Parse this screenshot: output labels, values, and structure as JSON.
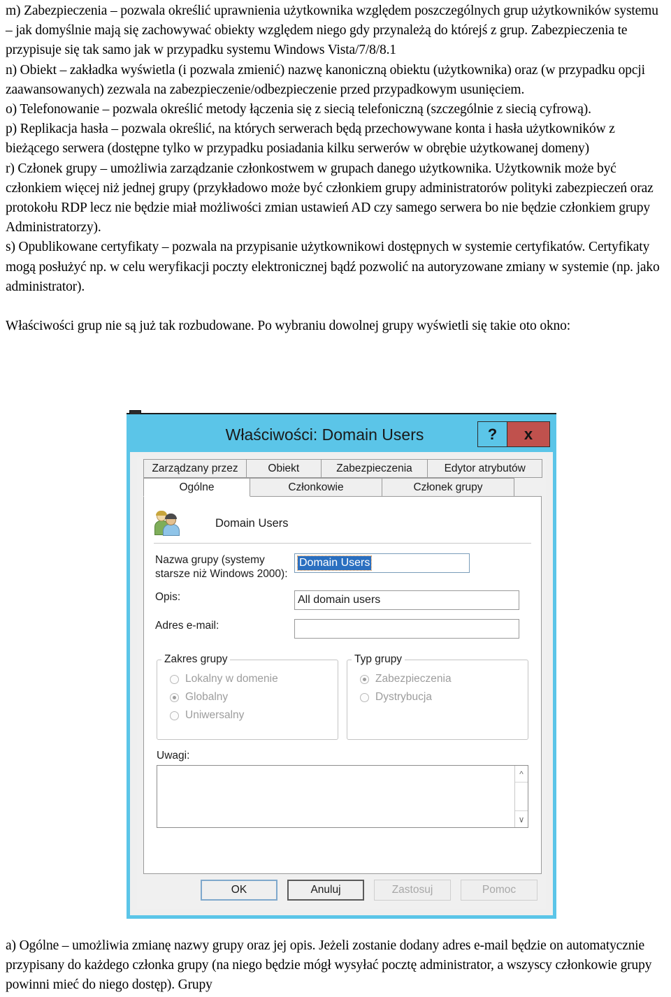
{
  "document": {
    "paragraphs": [
      "m) Zabezpieczenia – pozwala określić uprawnienia użytkownika względem poszczególnych grup użytkowników systemu – jak domyślnie mają się zachowywać obiekty względem niego gdy przynależą do którejś z grup. Zabezpieczenia te przypisuje się tak samo jak w przypadku systemu Windows Vista/7/8/8.1",
      "n) Obiekt – zakładka wyświetla (i pozwala zmienić) nazwę kanoniczną obiektu (użytkownika) oraz (w przypadku opcji zaawansowanych) zezwala na zabezpieczenie/odbezpieczenie przed przypadkowym usunięciem.",
      "o) Telefonowanie – pozwala określić metody łączenia się z siecią telefoniczną (szczególnie z siecią cyfrową).",
      "p) Replikacja hasła – pozwala określić, na których serwerach będą przechowywane konta i hasła użytkowników z bieżącego serwera (dostępne tylko w przypadku posiadania kilku serwerów w obrębie użytkowanej domeny)",
      "r) Członek grupy – umożliwia zarządzanie członkostwem w grupach danego użytkownika. Użytkownik może być członkiem więcej niż jednej grupy (przykładowo może być członkiem grupy administratorów polityki zabezpieczeń oraz protokołu RDP lecz nie będzie miał możliwości zmian ustawień AD czy samego serwera bo nie będzie członkiem grupy Administratorzy).",
      "s) Opublikowane certyfikaty – pozwala na przypisanie użytkownikowi dostępnych w systemie certyfikatów. Certyfikaty mogą posłużyć np. w celu weryfikacji poczty elektronicznej bądź pozwolić na autoryzowane zmiany w systemie (np. jako administrator)."
    ],
    "intro_paragraph": "Właściwości grup nie są już tak rozbudowane. Po wybraniu dowolnej grupy wyświetli się takie oto okno:",
    "closing_paragraph": "a) Ogólne – umożliwia zmianę nazwy grupy oraz jej opis. Jeżeli zostanie dodany adres e-mail będzie on automatycznie przypisany do każdego członka grupy (na niego będzie mógł wysyłać pocztę administrator, a wszyscy członkowie grupy powinni mieć do niego dostęp). Grupy"
  },
  "dialog": {
    "title": "Właściwości: Domain Users",
    "help_button": "?",
    "close_button": "x",
    "titlebar_color": "#5bc5e8",
    "close_button_color": "#c0514d",
    "tabs_row1": [
      {
        "label": "Zarządzany przez",
        "active": false
      },
      {
        "label": "Obiekt",
        "active": false
      },
      {
        "label": "Zabezpieczenia",
        "active": false
      },
      {
        "label": "Edytor atrybutów",
        "active": false
      }
    ],
    "tabs_row2": [
      {
        "label": "Ogólne",
        "active": true
      },
      {
        "label": "Członkowie",
        "active": false
      },
      {
        "label": "Członek grupy",
        "active": false
      }
    ],
    "header": {
      "icon": "group-users-icon",
      "object_name": "Domain Users"
    },
    "fields": [
      {
        "label": "Nazwa grupy (systemy starsze niż Windows 2000):",
        "value": "Domain Users",
        "placeholder": "",
        "selected": true
      },
      {
        "label": "Opis:",
        "value": "All domain users",
        "placeholder": "",
        "selected": false
      },
      {
        "label": "Adres e-mail:",
        "value": "",
        "placeholder": "",
        "selected": false
      }
    ],
    "group_scope": {
      "legend": "Zakres grupy",
      "options": [
        {
          "label": "Lokalny w domenie",
          "selected": false
        },
        {
          "label": "Globalny",
          "selected": true
        },
        {
          "label": "Uniwersalny",
          "selected": false
        }
      ]
    },
    "group_type": {
      "legend": "Typ grupy",
      "options": [
        {
          "label": "Zabezpieczenia",
          "selected": true
        },
        {
          "label": "Dystrybucja",
          "selected": false
        }
      ]
    },
    "notes": {
      "label": "Uwagi:",
      "value": "",
      "scroll_up_icon": "chevron-up-icon",
      "scroll_down_icon": "chevron-down-icon"
    },
    "buttons": [
      {
        "label": "OK",
        "state": "focused"
      },
      {
        "label": "Anuluj",
        "state": "default"
      },
      {
        "label": "Zastosuj",
        "state": "disabled"
      },
      {
        "label": "Pomoc",
        "state": "disabled"
      }
    ]
  }
}
